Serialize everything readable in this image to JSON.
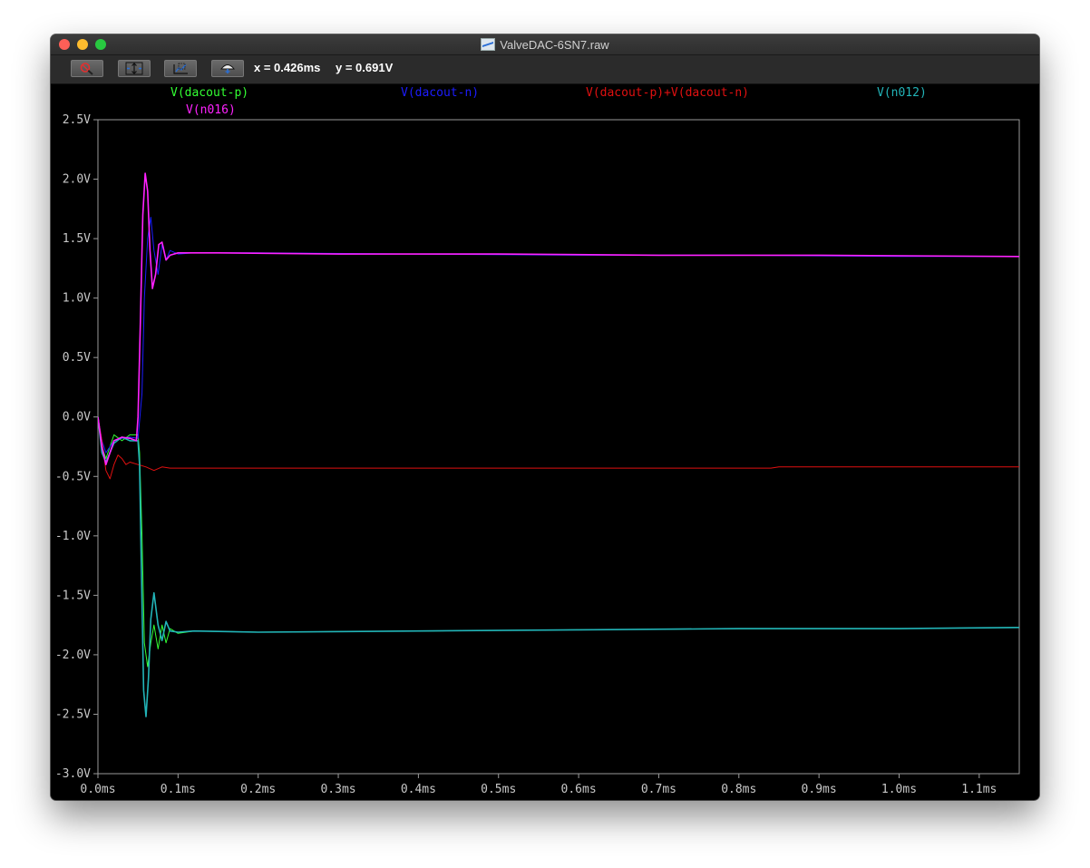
{
  "window": {
    "title": "ValveDAC-6SN7.raw"
  },
  "toolbar": {
    "buttons": [
      {
        "name": "zoom-tool-button",
        "icon": "zoom-cancel-icon"
      },
      {
        "name": "autorange-y-button",
        "icon": "autorange-icon"
      },
      {
        "name": "zoom-rect-button",
        "icon": "zoom-rect-icon"
      },
      {
        "name": "pan-button",
        "icon": "umbrella-icon"
      }
    ],
    "cursor_x": "x = 0.426ms",
    "cursor_y": "y = 0.691V"
  },
  "colors": {
    "background": "#000000",
    "grid": "#9a9a9a",
    "dacout_p": "#33ff33",
    "dacout_n": "#1c1cff",
    "sum": "#e01010",
    "n012": "#22b4b8",
    "n016": "#ff22ff"
  },
  "chart_data": {
    "type": "line",
    "xlabel": "",
    "ylabel": "",
    "xlim": [
      0,
      1.15
    ],
    "ylim": [
      -3.0,
      2.5
    ],
    "x_ticks": [
      "0.0ms",
      "0.1ms",
      "0.2ms",
      "0.3ms",
      "0.4ms",
      "0.5ms",
      "0.6ms",
      "0.7ms",
      "0.8ms",
      "0.9ms",
      "1.0ms",
      "1.1ms"
    ],
    "x_tick_values": [
      0,
      0.1,
      0.2,
      0.3,
      0.4,
      0.5,
      0.6,
      0.7,
      0.8,
      0.9,
      1.0,
      1.1
    ],
    "y_ticks": [
      "2.5V",
      "2.0V",
      "1.5V",
      "1.0V",
      "0.5V",
      "0.0V",
      "-0.5V",
      "-1.0V",
      "-1.5V",
      "-2.0V",
      "-2.5V",
      "-3.0V"
    ],
    "y_tick_values": [
      2.5,
      2.0,
      1.5,
      1.0,
      0.5,
      0.0,
      -0.5,
      -1.0,
      -1.5,
      -2.0,
      -2.5,
      -3.0
    ],
    "series": [
      {
        "name": "V(dacout-p)",
        "color": "#33ff33",
        "points": [
          [
            0,
            0
          ],
          [
            0.005,
            -0.25
          ],
          [
            0.01,
            -0.35
          ],
          [
            0.02,
            -0.15
          ],
          [
            0.03,
            -0.2
          ],
          [
            0.04,
            -0.15
          ],
          [
            0.05,
            -0.15
          ],
          [
            0.052,
            -0.3
          ],
          [
            0.055,
            -1.0
          ],
          [
            0.058,
            -1.9
          ],
          [
            0.062,
            -2.1
          ],
          [
            0.066,
            -1.9
          ],
          [
            0.07,
            -1.75
          ],
          [
            0.075,
            -1.95
          ],
          [
            0.08,
            -1.75
          ],
          [
            0.085,
            -1.9
          ],
          [
            0.09,
            -1.78
          ],
          [
            0.1,
            -1.82
          ],
          [
            0.12,
            -1.8
          ],
          [
            0.2,
            -1.81
          ],
          [
            0.4,
            -1.8
          ],
          [
            0.6,
            -1.79
          ],
          [
            0.8,
            -1.78
          ],
          [
            1.0,
            -1.78
          ],
          [
            1.15,
            -1.77
          ]
        ]
      },
      {
        "name": "V(dacout-n)",
        "color": "#1c1cff",
        "points": [
          [
            0,
            0
          ],
          [
            0.005,
            -0.2
          ],
          [
            0.01,
            -0.3
          ],
          [
            0.02,
            -0.2
          ],
          [
            0.03,
            -0.18
          ],
          [
            0.04,
            -0.17
          ],
          [
            0.05,
            -0.18
          ],
          [
            0.055,
            0.2
          ],
          [
            0.058,
            1.0
          ],
          [
            0.062,
            1.5
          ],
          [
            0.066,
            1.68
          ],
          [
            0.07,
            1.4
          ],
          [
            0.075,
            1.2
          ],
          [
            0.08,
            1.45
          ],
          [
            0.085,
            1.32
          ],
          [
            0.09,
            1.4
          ],
          [
            0.1,
            1.37
          ],
          [
            0.12,
            1.38
          ],
          [
            0.2,
            1.38
          ],
          [
            0.4,
            1.37
          ],
          [
            0.6,
            1.36
          ],
          [
            0.8,
            1.36
          ],
          [
            1.0,
            1.35
          ],
          [
            1.15,
            1.35
          ]
        ]
      },
      {
        "name": "V(dacout-p)+V(dacout-n)",
        "color": "#e01010",
        "points": [
          [
            0,
            0
          ],
          [
            0.005,
            -0.2
          ],
          [
            0.01,
            -0.45
          ],
          [
            0.015,
            -0.52
          ],
          [
            0.02,
            -0.4
          ],
          [
            0.025,
            -0.32
          ],
          [
            0.03,
            -0.35
          ],
          [
            0.035,
            -0.4
          ],
          [
            0.04,
            -0.38
          ],
          [
            0.05,
            -0.4
          ],
          [
            0.06,
            -0.42
          ],
          [
            0.07,
            -0.45
          ],
          [
            0.08,
            -0.42
          ],
          [
            0.09,
            -0.43
          ],
          [
            0.12,
            -0.43
          ],
          [
            0.3,
            -0.43
          ],
          [
            0.6,
            -0.43
          ],
          [
            0.84,
            -0.43
          ],
          [
            0.85,
            -0.42
          ],
          [
            1.15,
            -0.42
          ]
        ]
      },
      {
        "name": "V(n012)",
        "color": "#22b4b8",
        "points": [
          [
            0,
            0
          ],
          [
            0.005,
            -0.3
          ],
          [
            0.01,
            -0.38
          ],
          [
            0.02,
            -0.22
          ],
          [
            0.03,
            -0.17
          ],
          [
            0.04,
            -0.2
          ],
          [
            0.05,
            -0.2
          ],
          [
            0.052,
            -0.4
          ],
          [
            0.054,
            -1.2
          ],
          [
            0.057,
            -2.3
          ],
          [
            0.06,
            -2.52
          ],
          [
            0.063,
            -2.2
          ],
          [
            0.066,
            -1.7
          ],
          [
            0.07,
            -1.48
          ],
          [
            0.075,
            -1.75
          ],
          [
            0.08,
            -1.88
          ],
          [
            0.085,
            -1.72
          ],
          [
            0.09,
            -1.8
          ],
          [
            0.1,
            -1.81
          ],
          [
            0.12,
            -1.8
          ],
          [
            0.2,
            -1.81
          ],
          [
            0.4,
            -1.8
          ],
          [
            0.6,
            -1.79
          ],
          [
            0.8,
            -1.78
          ],
          [
            1.0,
            -1.78
          ],
          [
            1.15,
            -1.77
          ]
        ]
      },
      {
        "name": "V(n016)",
        "color": "#ff22ff",
        "points": [
          [
            0,
            0
          ],
          [
            0.005,
            -0.25
          ],
          [
            0.01,
            -0.4
          ],
          [
            0.015,
            -0.3
          ],
          [
            0.02,
            -0.2
          ],
          [
            0.03,
            -0.17
          ],
          [
            0.04,
            -0.18
          ],
          [
            0.048,
            -0.2
          ],
          [
            0.05,
            0.0
          ],
          [
            0.053,
            0.8
          ],
          [
            0.056,
            1.7
          ],
          [
            0.059,
            2.05
          ],
          [
            0.062,
            1.9
          ],
          [
            0.065,
            1.4
          ],
          [
            0.068,
            1.08
          ],
          [
            0.072,
            1.2
          ],
          [
            0.076,
            1.45
          ],
          [
            0.08,
            1.47
          ],
          [
            0.085,
            1.32
          ],
          [
            0.09,
            1.36
          ],
          [
            0.1,
            1.38
          ],
          [
            0.15,
            1.38
          ],
          [
            0.3,
            1.37
          ],
          [
            0.5,
            1.37
          ],
          [
            0.7,
            1.36
          ],
          [
            0.9,
            1.36
          ],
          [
            1.15,
            1.35
          ]
        ]
      }
    ]
  }
}
